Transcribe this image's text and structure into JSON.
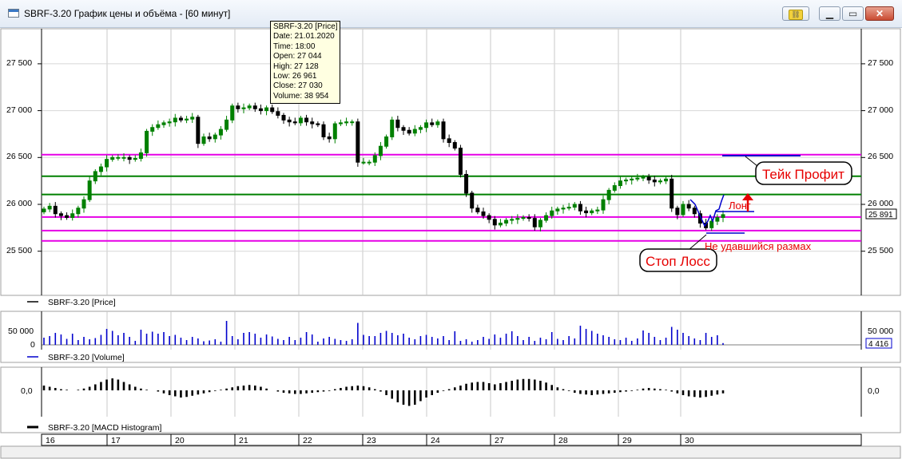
{
  "window": {
    "title": "SBRF-3.20 График цены и объёма - [60 минут]",
    "pin_icon": "link-icon",
    "minimize_icon": "minimize-icon",
    "maximize_icon": "maximize-icon",
    "close_icon": "close-icon"
  },
  "tooltip": {
    "lines": [
      "SBRF-3.20 [Price]",
      "Date: 21.01.2020",
      "Time: 18:00",
      "Open:  27 044",
      "High:   27 128",
      "Low:    26 961",
      "Close: 27 030",
      "Volume: 38 954"
    ]
  },
  "price_panel": {
    "legend": "SBRF-3.20 [Price]",
    "y_ticks": [
      {
        "value": 27500,
        "label": "27 500"
      },
      {
        "value": 27000,
        "label": "27 000"
      },
      {
        "value": 26500,
        "label": "26 500"
      },
      {
        "value": 26000,
        "label": "26 000"
      },
      {
        "value": 25500,
        "label": "25 500"
      }
    ],
    "last_price": "25 891",
    "last_value": 25891
  },
  "volume_panel": {
    "legend": "SBRF-3.20 [Volume]",
    "tick_top": "50 000",
    "tick_bottom": "0",
    "last_volume": "4 416"
  },
  "macd_panel": {
    "legend": "SBRF-3.20 [MACD Histogram]",
    "tick_zero": "0,0"
  },
  "annotations": {
    "take_profit": "Тейк Профит",
    "stop_loss": "Стоп Лосс",
    "long": "Лонг",
    "failed_swing": "Не удавшийся размах"
  },
  "colors": {
    "magenta_line": "#e600e6",
    "green_line": "#008000",
    "up_candle": "#008000",
    "down_candle": "#000000",
    "volume_bar": "#0000cc",
    "annotation_red": "#e60000",
    "annotation_blue": "#0000cc"
  },
  "chart_data": {
    "type": "candlestick",
    "x_labels": [
      "16",
      "17",
      "20",
      "21",
      "22",
      "23",
      "24",
      "27",
      "28",
      "29",
      "30"
    ],
    "horizontal_levels": [
      {
        "value": 26530,
        "color": "magenta"
      },
      {
        "value": 26300,
        "color": "green"
      },
      {
        "value": 26105,
        "color": "green"
      },
      {
        "value": 25865,
        "color": "magenta"
      },
      {
        "value": 25720,
        "color": "magenta"
      },
      {
        "value": 25610,
        "color": "magenta"
      }
    ],
    "close_path": [
      25950,
      25980,
      25900,
      25880,
      25860,
      25900,
      25960,
      26050,
      26250,
      26350,
      26400,
      26480,
      26500,
      26500,
      26500,
      26480,
      26490,
      26550,
      26780,
      26820,
      26850,
      26870,
      26880,
      26920,
      26900,
      26910,
      26930,
      26650,
      26720,
      26700,
      26740,
      26800,
      26900,
      27050,
      27020,
      27030,
      27050,
      27020,
      27000,
      27030,
      26990,
      26950,
      26900,
      26880,
      26870,
      26920,
      26880,
      26860,
      26850,
      26720,
      26700,
      26860,
      26870,
      26880,
      26880,
      26450,
      26450,
      26450,
      26520,
      26620,
      26720,
      26900,
      26820,
      26790,
      26760,
      26800,
      26820,
      26870,
      26850,
      26880,
      26700,
      26660,
      26600,
      26320,
      26120,
      25960,
      25920,
      25880,
      25840,
      25780,
      25800,
      25830,
      25840,
      25850,
      25860,
      25850,
      25760,
      25830,
      25880,
      25930,
      25950,
      25960,
      25970,
      26000,
      25930,
      25910,
      25930,
      25940,
      26050,
      26150,
      26200,
      26250,
      26260,
      26270,
      26280,
      26290,
      26260,
      26240,
      26250,
      26270,
      25960,
      25890,
      26000,
      25960,
      25900,
      25800,
      25750,
      25820,
      25860,
      25890
    ],
    "volume_path": [
      18000,
      22000,
      30000,
      26000,
      15000,
      28000,
      12000,
      20000,
      14000,
      17000,
      25000,
      40000,
      35000,
      24000,
      30000,
      20000,
      10000,
      38000,
      28000,
      33000,
      28000,
      32000,
      22000,
      25000,
      18000,
      12000,
      20000,
      16000,
      9000,
      11000,
      14000,
      8000,
      60000,
      22000,
      14000,
      30000,
      32000,
      28000,
      18000,
      26000,
      21000,
      15000,
      12000,
      20000,
      12000,
      18000,
      32000,
      26000,
      8000,
      16000,
      20000,
      15000,
      12000,
      10000,
      14000,
      55000,
      25000,
      22000,
      22000,
      30000,
      35000,
      30000,
      24000,
      28000,
      18000,
      14000,
      22000,
      25000,
      20000,
      16000,
      22000,
      12000,
      34000,
      10000,
      14000,
      8000,
      12000,
      20000,
      15000,
      26000,
      18000,
      28000,
      34000,
      22000,
      12000,
      20000,
      10000,
      18000,
      14000,
      32000,
      15000,
      12000,
      22000,
      16000,
      48000,
      40000,
      35000,
      28000,
      24000,
      20000,
      14000,
      12000,
      18000,
      10000,
      16000,
      36000,
      30000,
      20000,
      12000,
      18000,
      45000,
      38000,
      30000,
      22000,
      16000,
      12000,
      30000,
      20000,
      24000,
      4416
    ],
    "macd_path": [
      8,
      6,
      4,
      2,
      1,
      0,
      1,
      3,
      6,
      10,
      14,
      18,
      20,
      18,
      14,
      10,
      6,
      3,
      1,
      0,
      -2,
      -5,
      -8,
      -10,
      -12,
      -11,
      -9,
      -7,
      -5,
      -3,
      -1,
      1,
      3,
      5,
      7,
      8,
      9,
      8,
      6,
      3,
      0,
      -2,
      -4,
      -5,
      -6,
      -6,
      -5,
      -4,
      -3,
      -2,
      -1,
      2,
      4,
      6,
      7,
      8,
      7,
      5,
      2,
      -2,
      -8,
      -14,
      -20,
      -24,
      -26,
      -24,
      -18,
      -12,
      -8,
      -4,
      -1,
      2,
      5,
      8,
      11,
      13,
      14,
      14,
      12,
      10,
      12,
      14,
      16,
      18,
      19,
      19,
      18,
      16,
      13,
      9,
      5,
      2,
      -1,
      -4,
      -6,
      -7,
      -8,
      -7,
      -6,
      -5,
      -4,
      -3,
      -2,
      -1,
      1,
      3,
      4,
      3,
      2,
      1,
      -2,
      -5,
      -8,
      -10,
      -11,
      -12,
      -11,
      -9,
      -7,
      -5
    ]
  }
}
